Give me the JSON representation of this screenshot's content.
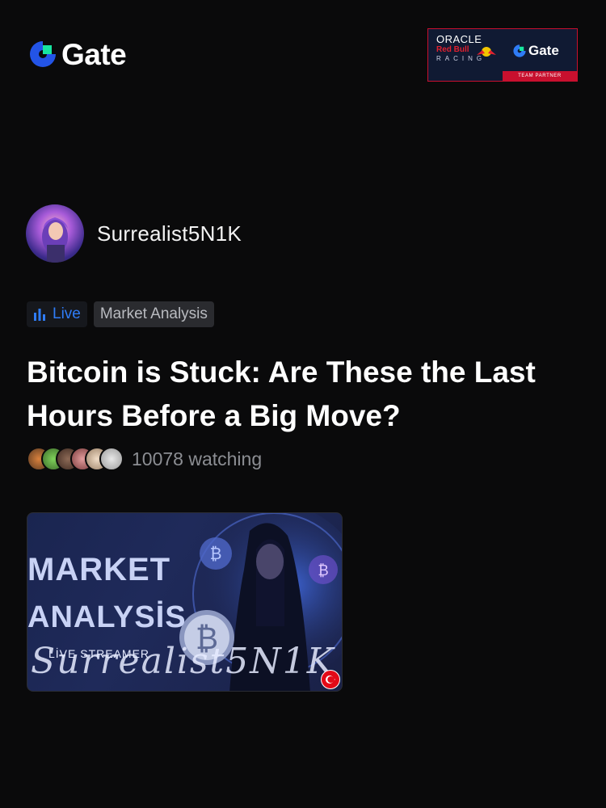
{
  "header": {
    "brand": "Gate",
    "partner": {
      "line1": "ORACLE",
      "line2": "Red Bull",
      "line3": "RACING",
      "brand": "Gate",
      "badge": "TEAM PARTNER"
    }
  },
  "author": {
    "name": "Surrealist5N1K",
    "avatar_label": "Surrealist5N1K"
  },
  "tags": {
    "live": "Live",
    "category": "Market Analysis"
  },
  "post": {
    "title": "Bitcoin is Stuck: Are These the Last Hours Before a Big Move?",
    "watching": "10078 watching"
  },
  "thumbnail": {
    "line1": "MARKET",
    "line2": "ANALYSİS",
    "line3": "LİVE STREAMER",
    "signature": "Surrealist5N1K"
  },
  "colors": {
    "background": "#0a0a0b",
    "live_blue": "#2f7cf6",
    "gate_green": "#17e5a0",
    "gate_blue": "#2354e6"
  }
}
